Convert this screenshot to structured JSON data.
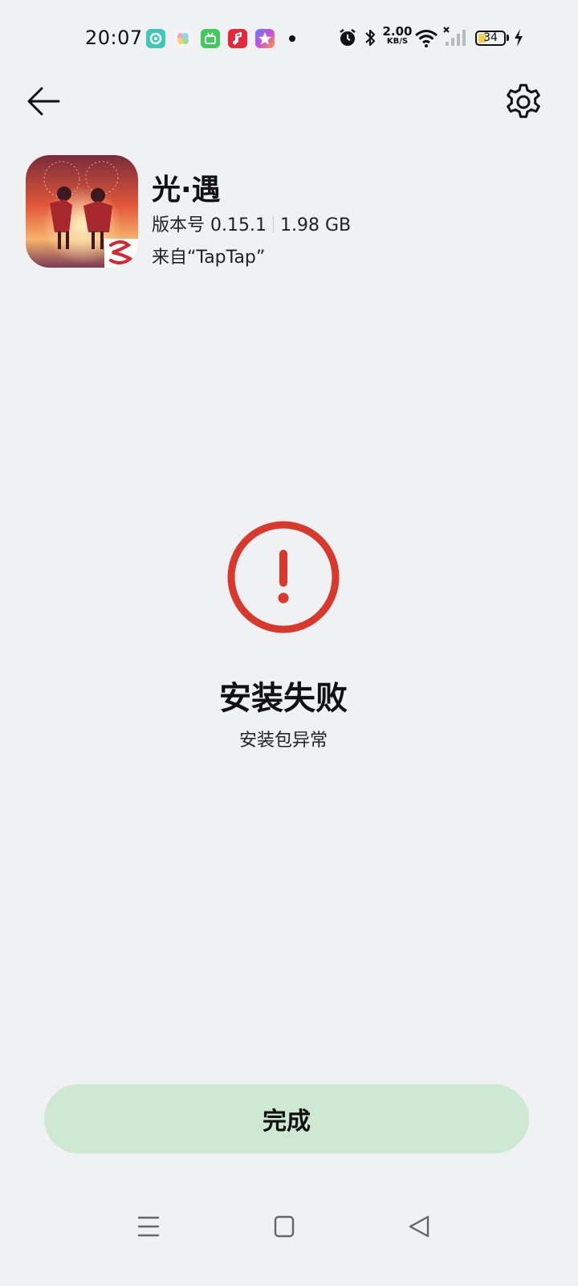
{
  "status_bar": {
    "time": "20:07",
    "notification_icons": [
      "soul-app-icon",
      "petal-app-icon",
      "bilibili-green-icon",
      "music-app-icon",
      "star-app-icon"
    ],
    "net_speed_value": "2.00",
    "net_speed_unit": "KB/S",
    "battery_level": "34",
    "battery_percent": 34,
    "battery_fill_color": "#f0cf57"
  },
  "toolbar": {
    "back_icon": "arrow-left-icon",
    "settings_icon": "gear-icon"
  },
  "app": {
    "name": "光·遇",
    "version": "版本号 0.15.1",
    "size": "1.98 GB",
    "source": "来自“TapTap”"
  },
  "result": {
    "icon": "exclamation-circle-icon",
    "title": "安装失败",
    "subtitle": "安装包异常",
    "accent_color": "#d9382d"
  },
  "actions": {
    "done_label": "完成",
    "done_color": "#cee9d2"
  },
  "nav_bar": {
    "menu_icon": "menu-icon",
    "home_icon": "home-square-icon",
    "back_icon": "back-triangle-icon"
  }
}
